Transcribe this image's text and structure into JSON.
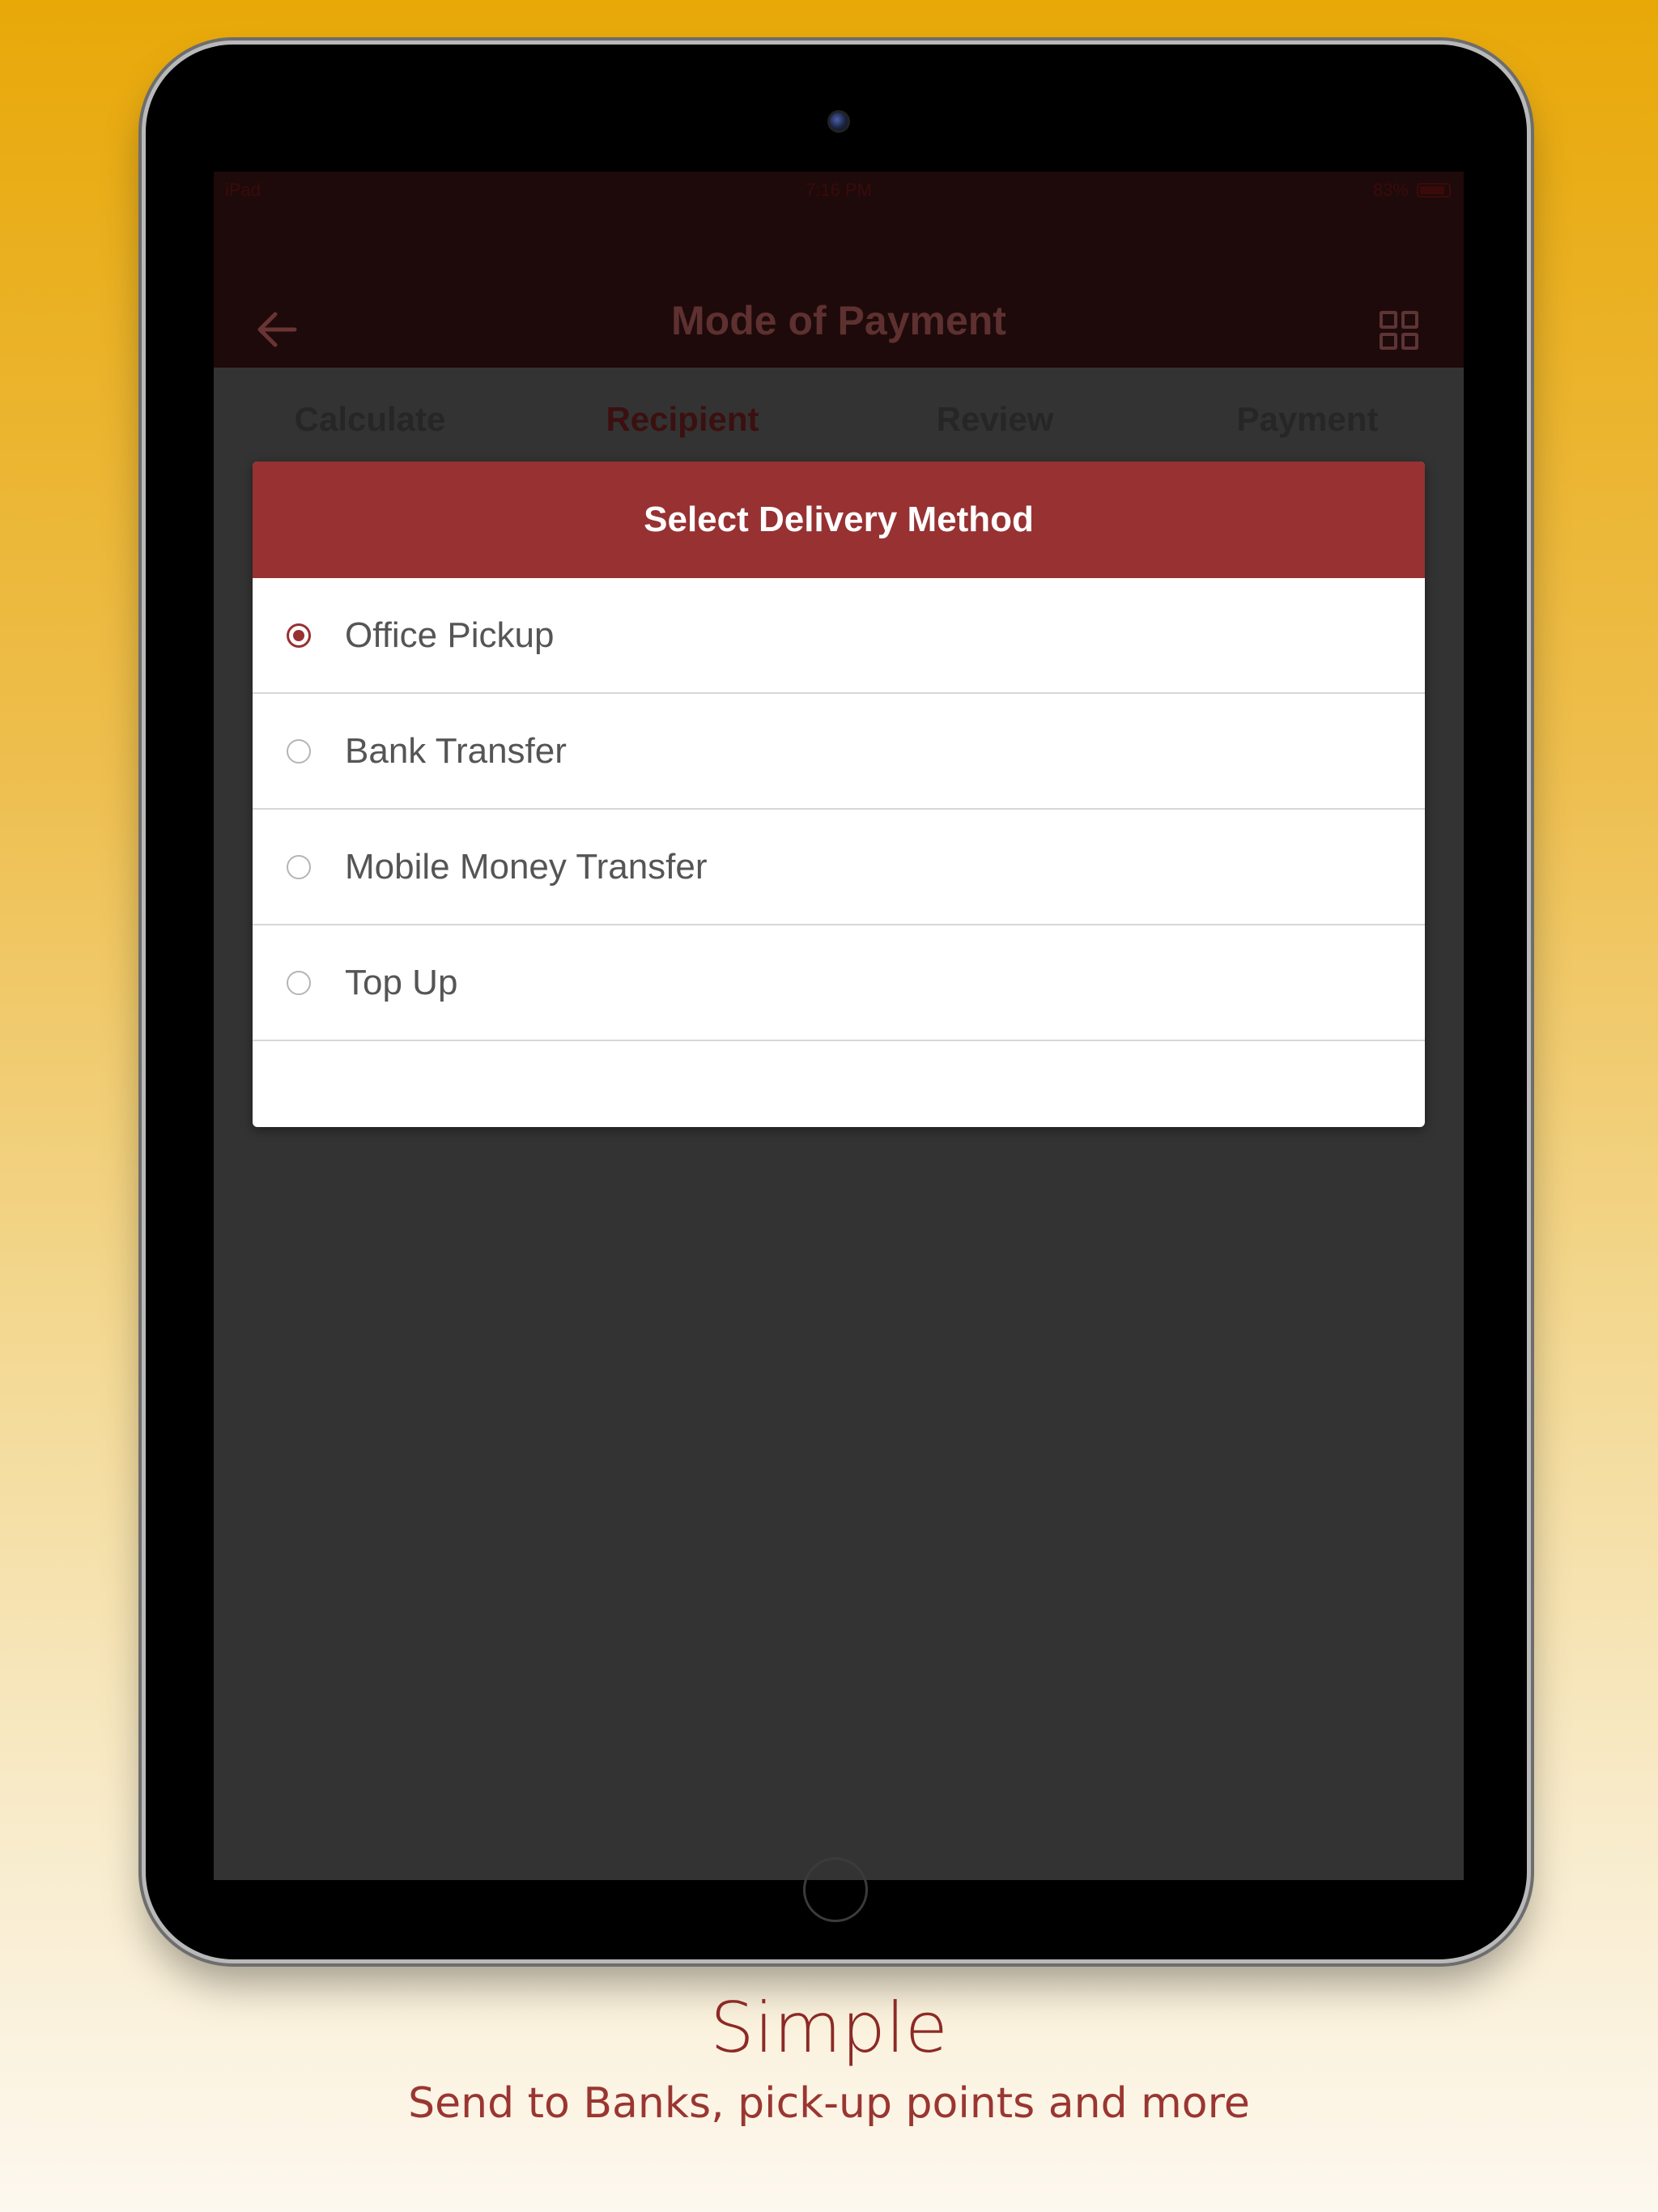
{
  "status_bar": {
    "device": "iPad",
    "time": "7:16 PM",
    "battery": "83%"
  },
  "header": {
    "title": "Mode of Payment",
    "back_icon": "arrow-left-icon",
    "menu_icon": "grid-icon"
  },
  "steps": [
    "Calculate",
    "Recipient",
    "Review",
    "Payment"
  ],
  "active_step": "Recipient",
  "dialog": {
    "title": "Select Delivery Method",
    "options": [
      {
        "label": "Office Pickup",
        "selected": true
      },
      {
        "label": "Bank Transfer",
        "selected": false
      },
      {
        "label": "Mobile Money Transfer",
        "selected": false
      },
      {
        "label": "Top Up",
        "selected": false
      }
    ]
  },
  "caption": {
    "title": "Simple",
    "subtitle": "Send to Banks, pick-up points and more"
  },
  "colors": {
    "accent": "#973132",
    "background_top": "#e8a808",
    "background_bottom": "#fdf8ef",
    "caption": "#8c2a26"
  }
}
